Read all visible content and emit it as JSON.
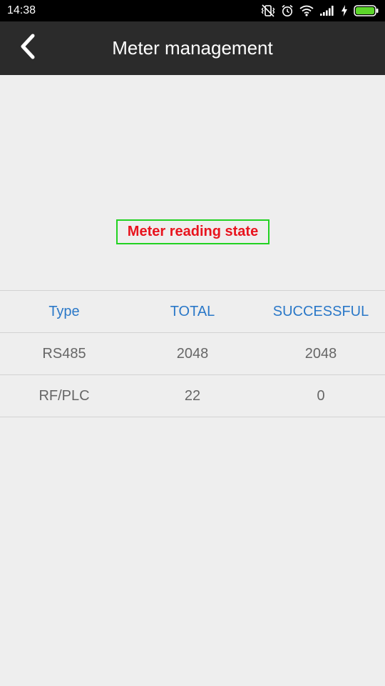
{
  "status_bar": {
    "time": "14:38",
    "icons": [
      "vibrate-off-icon",
      "alarm-clock-icon",
      "wifi-icon",
      "cellular-signal-icon",
      "charging-bolt-icon",
      "battery-icon"
    ],
    "battery_color": "#5cd62a"
  },
  "app_bar": {
    "title": "Meter management",
    "back_icon": "chevron-left-icon"
  },
  "state_label": "Meter reading state",
  "table": {
    "headers": [
      "Type",
      "TOTAL",
      "SUCCESSFUL"
    ],
    "rows": [
      [
        "RS485",
        "2048",
        "2048"
      ],
      [
        "RF/PLC",
        "22",
        "0"
      ]
    ]
  },
  "colors": {
    "header_text": "#2a78c8",
    "state_label_text": "#e8141e",
    "state_label_border": "#22d222",
    "app_bar_bg": "#2b2b2b"
  }
}
